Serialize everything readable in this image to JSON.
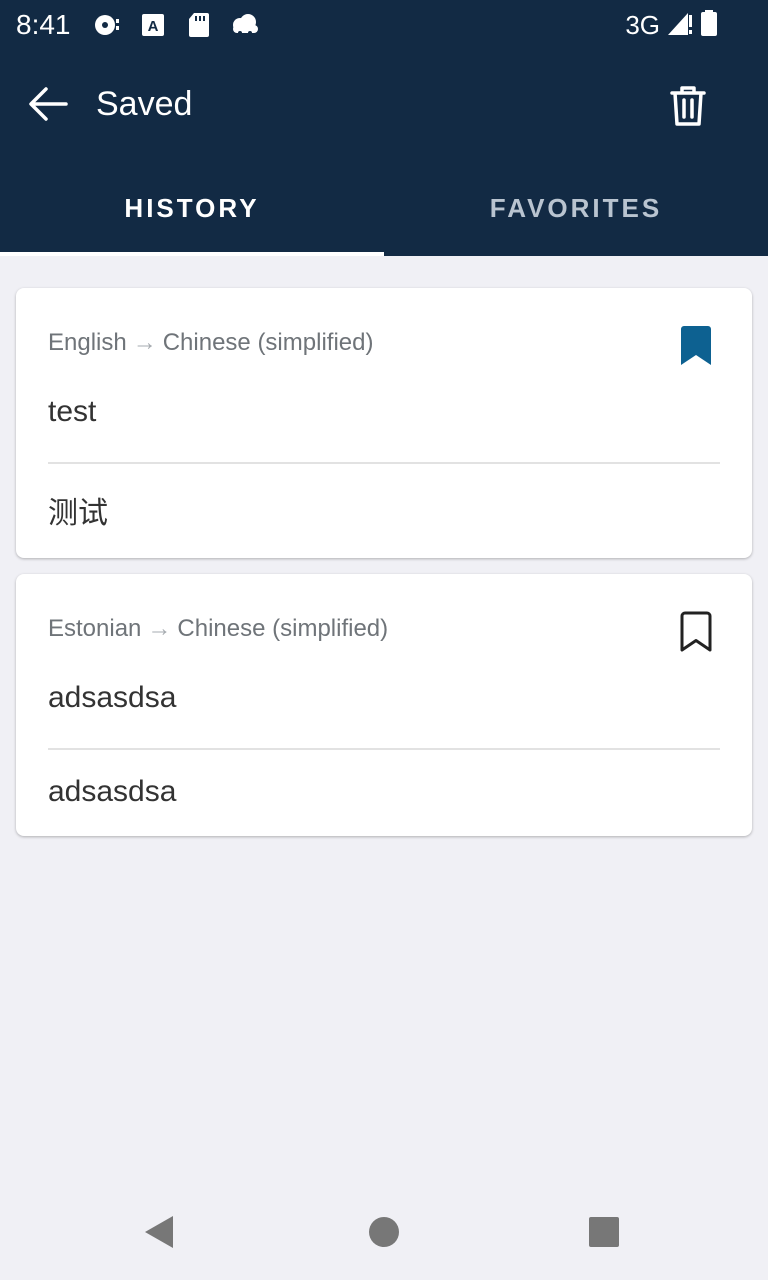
{
  "status_bar": {
    "time": "8:41",
    "network": "3G",
    "icons": [
      "media-icon",
      "a-badge-icon",
      "sd-card-icon",
      "cloud-icon",
      "signal-icon",
      "battery-icon"
    ]
  },
  "app_bar": {
    "title": "Saved",
    "back_icon": "arrow-left-icon",
    "delete_icon": "trash-icon"
  },
  "tabs": [
    {
      "label": "HISTORY",
      "selected": true
    },
    {
      "label": "FAVORITES",
      "selected": false
    }
  ],
  "entries": [
    {
      "source_lang": "English",
      "arrow": "→",
      "target_lang": "Chinese (simplified)",
      "source_text": "test",
      "target_text": "测试",
      "bookmarked": true
    },
    {
      "source_lang": "Estonian",
      "arrow": "→",
      "target_lang": "Chinese (simplified)",
      "source_text": "adsasdsa",
      "target_text": "adsasdsa",
      "bookmarked": false
    }
  ],
  "colors": {
    "app_bar_bg": "#122a44",
    "page_bg": "#f0f0f5",
    "bookmark_active": "#0d6191",
    "tab_inactive": "#b9c4d0"
  },
  "nav_bar": {
    "icons": [
      "nav-back-icon",
      "nav-home-icon",
      "nav-recent-icon"
    ]
  }
}
